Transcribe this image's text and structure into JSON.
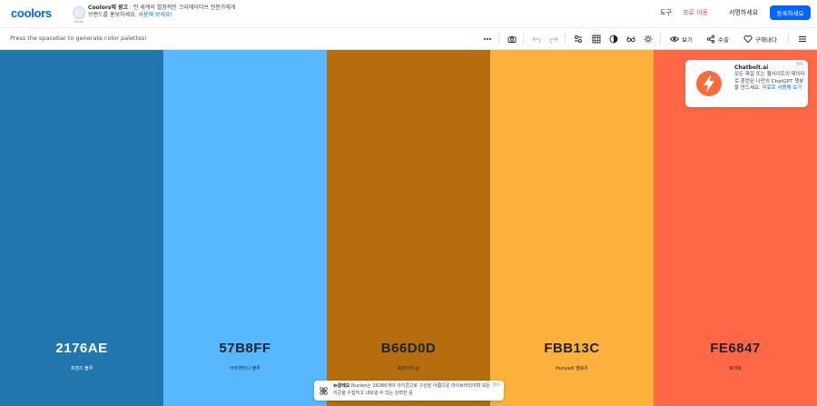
{
  "header": {
    "logo": "coolors",
    "ad": {
      "badge": "BRAND",
      "lead": "Coolors에 광고",
      "text": " : 전 세계의 열정적인 크리에이티브 전문가에게 브랜드를 홍보하세요.",
      "cta": "사용해 보세요!"
    },
    "nav": {
      "tools": "도구",
      "pro": "프로 이동",
      "sign_in": "서명하세요",
      "sign_up": "등록하세요"
    }
  },
  "toolbar": {
    "hint": "Press the spacebar to generate color palettes!",
    "view_label": "보기",
    "export_label": "수출",
    "save_label": "구해내다"
  },
  "palette": [
    {
      "hex": "2176AE",
      "name": "프렌즈 블루",
      "color": "#2176AE",
      "text_color": "#ffffff"
    },
    {
      "hex": "57B8FF",
      "name": "아르헨티나 블루",
      "color": "#57B8FF",
      "text_color": "#1f2430"
    },
    {
      "hex": "B66D0D",
      "name": "포탄이의 눈",
      "color": "#B66D0D",
      "text_color": "#1f2430"
    },
    {
      "hex": "FBB13C",
      "name": "Hunyadi 옐로우",
      "color": "#FBB13C",
      "text_color": "#1f2430"
    },
    {
      "hex": "FE6847",
      "name": "토마토",
      "color": "#FE6847",
      "text_color": "#1f2430"
    }
  ],
  "ad_card": {
    "tag": "광고",
    "title": "Chatbolt.ai",
    "body": "모든 파일 또는 웹사이트의 데이터로 훈련된 나만의 ChatGPT 챗봇을 만드세요.",
    "cta": "무료로 사용해 보기",
    "icon_color": "#FF6A3D"
  },
  "bottom_ad": {
    "tag": "광고",
    "lead": "뉴클레오",
    "text": " Nucleo는 29280개의 아이콘으로 구성된 아름다운 라이브러리이며 모든 아이콘을 수집하고 내보낼 수 있는 강력한 응"
  },
  "colors": {
    "brand": "#0066ff",
    "pro": "#e83d84"
  }
}
